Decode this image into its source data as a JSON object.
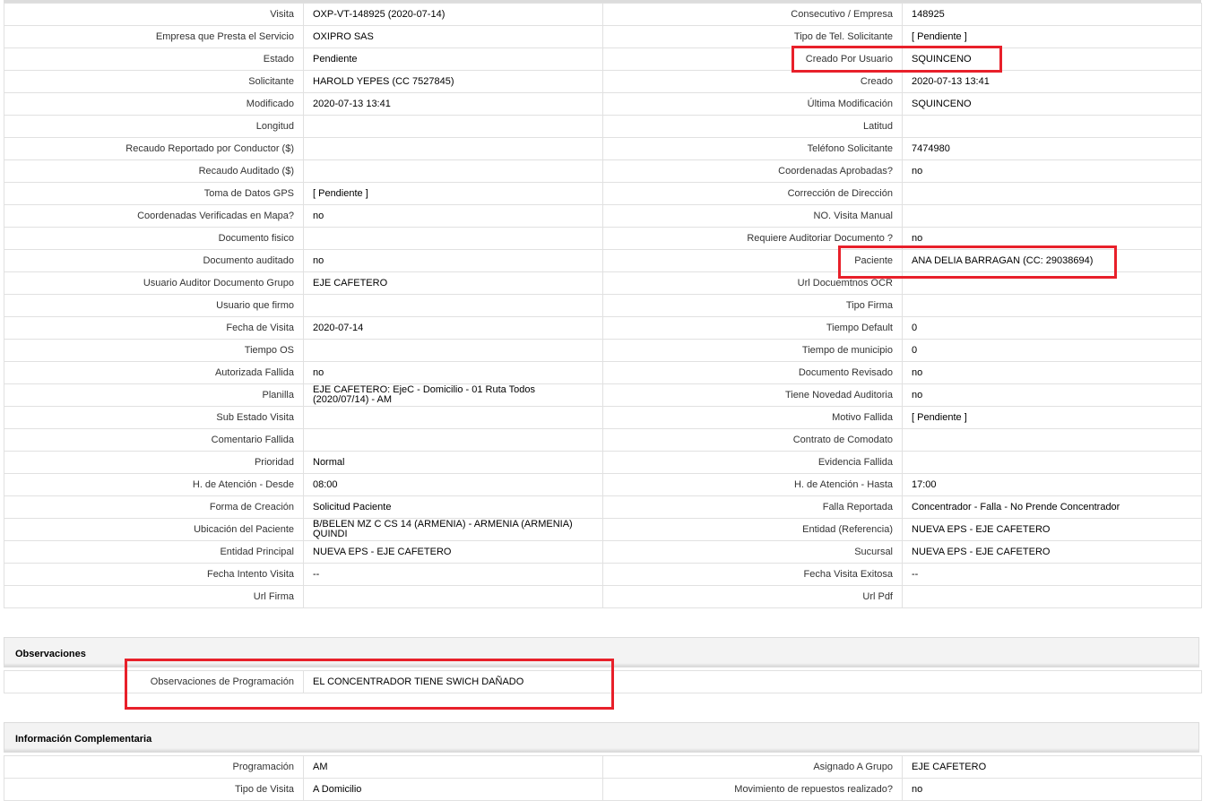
{
  "colors": {
    "highlight": "#e8202a",
    "border": "#e1e1e1",
    "panel_bg": "#f3f3f3"
  },
  "main_rows": [
    [
      [
        "Visita",
        "OXP-VT-148925 (2020-07-14)"
      ],
      [
        "Consecutivo / Empresa",
        "148925"
      ]
    ],
    [
      [
        "Empresa que Presta el Servicio",
        "OXIPRO SAS"
      ],
      [
        "Tipo de Tel. Solicitante",
        "[ Pendiente ]"
      ]
    ],
    [
      [
        "Estado",
        "Pendiente"
      ],
      [
        "Creado Por Usuario",
        "SQUINCENO"
      ]
    ],
    [
      [
        "Solicitante",
        "HAROLD YEPES (CC 7527845)"
      ],
      [
        "Creado",
        "2020-07-13 13:41"
      ]
    ],
    [
      [
        "Modificado",
        "2020-07-13 13:41"
      ],
      [
        "Última Modificación",
        " SQUINCENO"
      ]
    ],
    [
      [
        "Longitud",
        ""
      ],
      [
        "Latitud",
        ""
      ]
    ],
    [
      [
        "Recaudo Reportado por Conductor ($)",
        ""
      ],
      [
        "Teléfono Solicitante",
        "7474980"
      ]
    ],
    [
      [
        "Recaudo Auditado ($)",
        ""
      ],
      [
        "Coordenadas Aprobadas?",
        " no"
      ]
    ],
    [
      [
        "Toma de Datos GPS",
        "[ Pendiente ]"
      ],
      [
        "Corrección de Dirección",
        ""
      ]
    ],
    [
      [
        "Coordenadas Verificadas en Mapa?",
        " no"
      ],
      [
        "NO. Visita Manual",
        ""
      ]
    ],
    [
      [
        "Documento fisico",
        ""
      ],
      [
        "Requiere Auditoriar Documento ?",
        " no"
      ]
    ],
    [
      [
        "Documento auditado",
        " no"
      ],
      [
        "Paciente",
        "ANA DELIA BARRAGAN (CC: 29038694)"
      ]
    ],
    [
      [
        "Usuario Auditor Documento Grupo",
        "EJE CAFETERO"
      ],
      [
        "Url Docuemtnos OCR",
        ""
      ]
    ],
    [
      [
        "Usuario que firmo",
        ""
      ],
      [
        "Tipo Firma",
        ""
      ]
    ],
    [
      [
        "Fecha de Visita",
        " 2020-07-14"
      ],
      [
        "Tiempo Default",
        "0"
      ]
    ],
    [
      [
        "Tiempo OS",
        ""
      ],
      [
        "Tiempo de municipio",
        "0"
      ]
    ],
    [
      [
        "Autorizada Fallida",
        " no"
      ],
      [
        "Documento Revisado",
        " no"
      ]
    ],
    [
      [
        "Planilla",
        "EJE CAFETERO: EjeC - Domicilio - 01 Ruta Todos (2020/07/14) - AM"
      ],
      [
        "Tiene Novedad Auditoria",
        " no"
      ]
    ],
    [
      [
        "Sub Estado Visita",
        ""
      ],
      [
        "Motivo Fallida",
        "[ Pendiente ]"
      ]
    ],
    [
      [
        "Comentario Fallida",
        ""
      ],
      [
        "Contrato de Comodato",
        ""
      ]
    ],
    [
      [
        "Prioridad",
        "Normal"
      ],
      [
        "Evidencia Fallida",
        ""
      ]
    ],
    [
      [
        "H. de Atención - Desde",
        "08:00"
      ],
      [
        "H. de Atención - Hasta",
        "17:00"
      ]
    ],
    [
      [
        "Forma de Creación",
        "Solicitud Paciente"
      ],
      [
        "Falla Reportada",
        "Concentrador - Falla - No Prende Concentrador"
      ]
    ],
    [
      [
        "Ubicación del Paciente",
        "B/BELEN MZ C CS 14 (ARMENIA) - ARMENIA (ARMENIA) QUINDI"
      ],
      [
        "Entidad (Referencia)",
        "NUEVA EPS - EJE CAFETERO"
      ]
    ],
    [
      [
        "Entidad Principal",
        "NUEVA EPS - EJE CAFETERO"
      ],
      [
        "Sucursal",
        "NUEVA EPS - EJE CAFETERO"
      ]
    ],
    [
      [
        "Fecha Intento Visita",
        " --"
      ],
      [
        "Fecha Visita Exitosa",
        " --"
      ]
    ],
    [
      [
        "Url Firma",
        ""
      ],
      [
        "Url Pdf",
        ""
      ]
    ]
  ],
  "observaciones": {
    "title": "Observaciones",
    "label": "Observaciones de Programación",
    "value": " EL CONCENTRADOR TIENE SWICH DAÑADO"
  },
  "complementaria": {
    "title": "Información Complementaria",
    "rows": [
      [
        [
          "Programación",
          "AM"
        ],
        [
          "Asignado A Grupo",
          "EJE CAFETERO"
        ]
      ],
      [
        [
          "Tipo de Visita",
          "A Domicilio"
        ],
        [
          "Movimiento de repuestos realizado?",
          " no"
        ]
      ]
    ]
  }
}
